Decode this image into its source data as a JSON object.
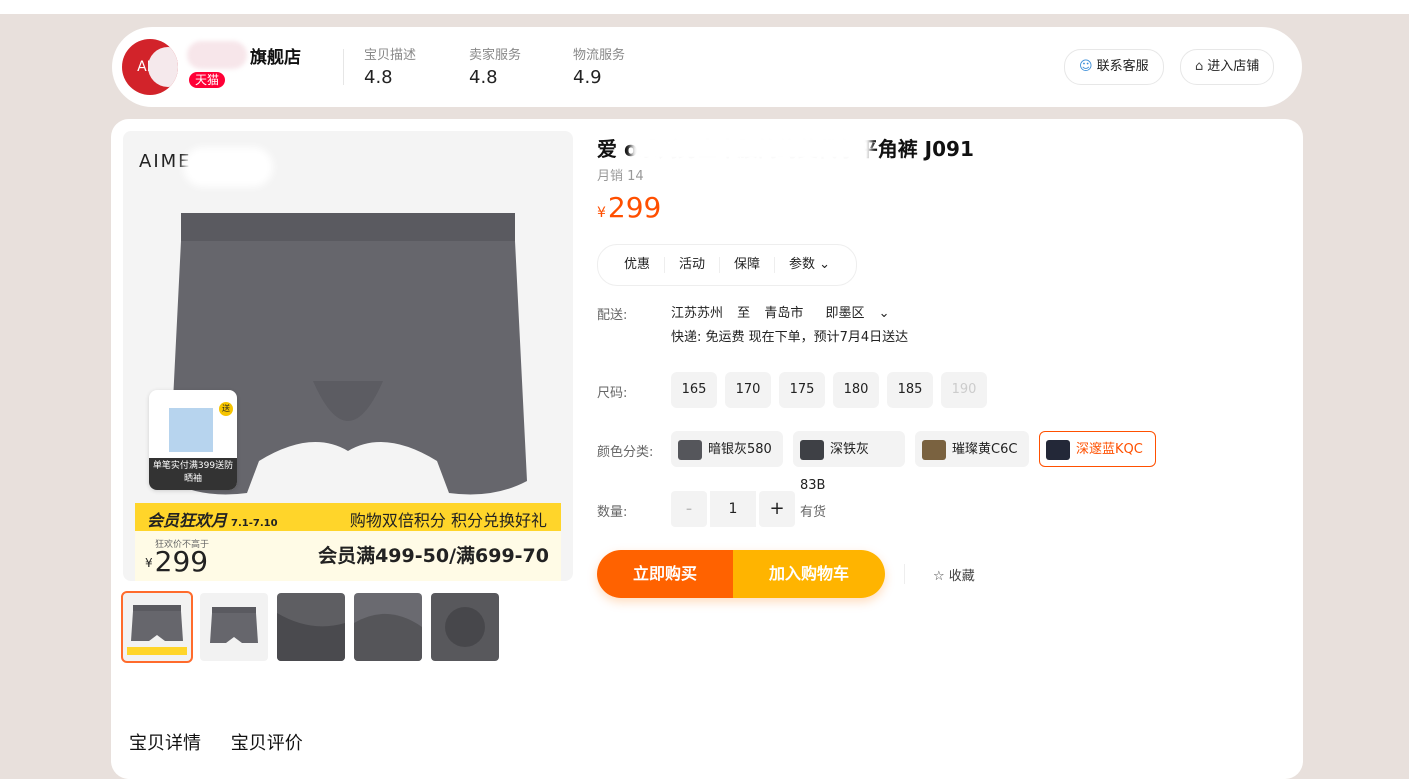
{
  "store": {
    "logo_text": "AIM",
    "name": "旗舰店",
    "badge": "天猫",
    "metrics": [
      {
        "label": "宝贝描述",
        "value": "4.8"
      },
      {
        "label": "卖家服务",
        "value": "4.8"
      },
      {
        "label": "物流服务",
        "value": "4.9"
      }
    ],
    "buttons": {
      "service": "联系客服",
      "shop": "进入店铺"
    }
  },
  "gallery": {
    "brand": "AIME",
    "gift_tag": "送",
    "gift_text": "单笔实付满399送防晒袖",
    "promo_title": "会员狂欢月",
    "promo_dates": "7.1-7.10",
    "promo_right": "购物双倍积分 积分兑换好礼",
    "promo_price_note": "狂欢价不高于",
    "promo_currency": "¥",
    "promo_price": "299",
    "promo_deal": "会员满499-50/满699-70"
  },
  "product": {
    "title": "爱                o系列男士中腰简约莫代尔平角裤    J091",
    "sales": "月销 14",
    "currency": "¥",
    "price": "299",
    "tabs": [
      "优惠",
      "活动",
      "保障",
      "参数 ⌄"
    ],
    "shipping_label": "配送:",
    "ship_from": "江苏苏州",
    "ship_to_word": "至",
    "ship_city": "青岛市",
    "ship_district": "即墨区",
    "ship_detail": "快递: 免运费  现在下单，预计7月4日送达",
    "size_label": "尺码:",
    "sizes": [
      "165",
      "170",
      "175",
      "180",
      "185",
      "190"
    ],
    "color_label": "颜色分类:",
    "colors": [
      {
        "name": "暗银灰580",
        "swatch": "#55565b"
      },
      {
        "name": "深铁灰83B",
        "swatch": "#3e4045"
      },
      {
        "name": "璀璨黄C6C",
        "swatch": "#7a6240"
      },
      {
        "name": "深邃蓝KQC",
        "swatch": "#232838"
      }
    ],
    "qty_label": "数量:",
    "qty_minus": "-",
    "qty_value": "1",
    "qty_plus": "+",
    "stock": "有货",
    "buy_now": "立即购买",
    "add_cart": "加入购物车",
    "favorite": "☆ 收藏"
  },
  "detail_tabs": [
    "宝贝详情",
    "宝贝评价"
  ],
  "colors": {
    "accent": "#ff5000",
    "buy": "#ff6200",
    "cart": "#ffb400",
    "tmall": "#ff0036"
  }
}
